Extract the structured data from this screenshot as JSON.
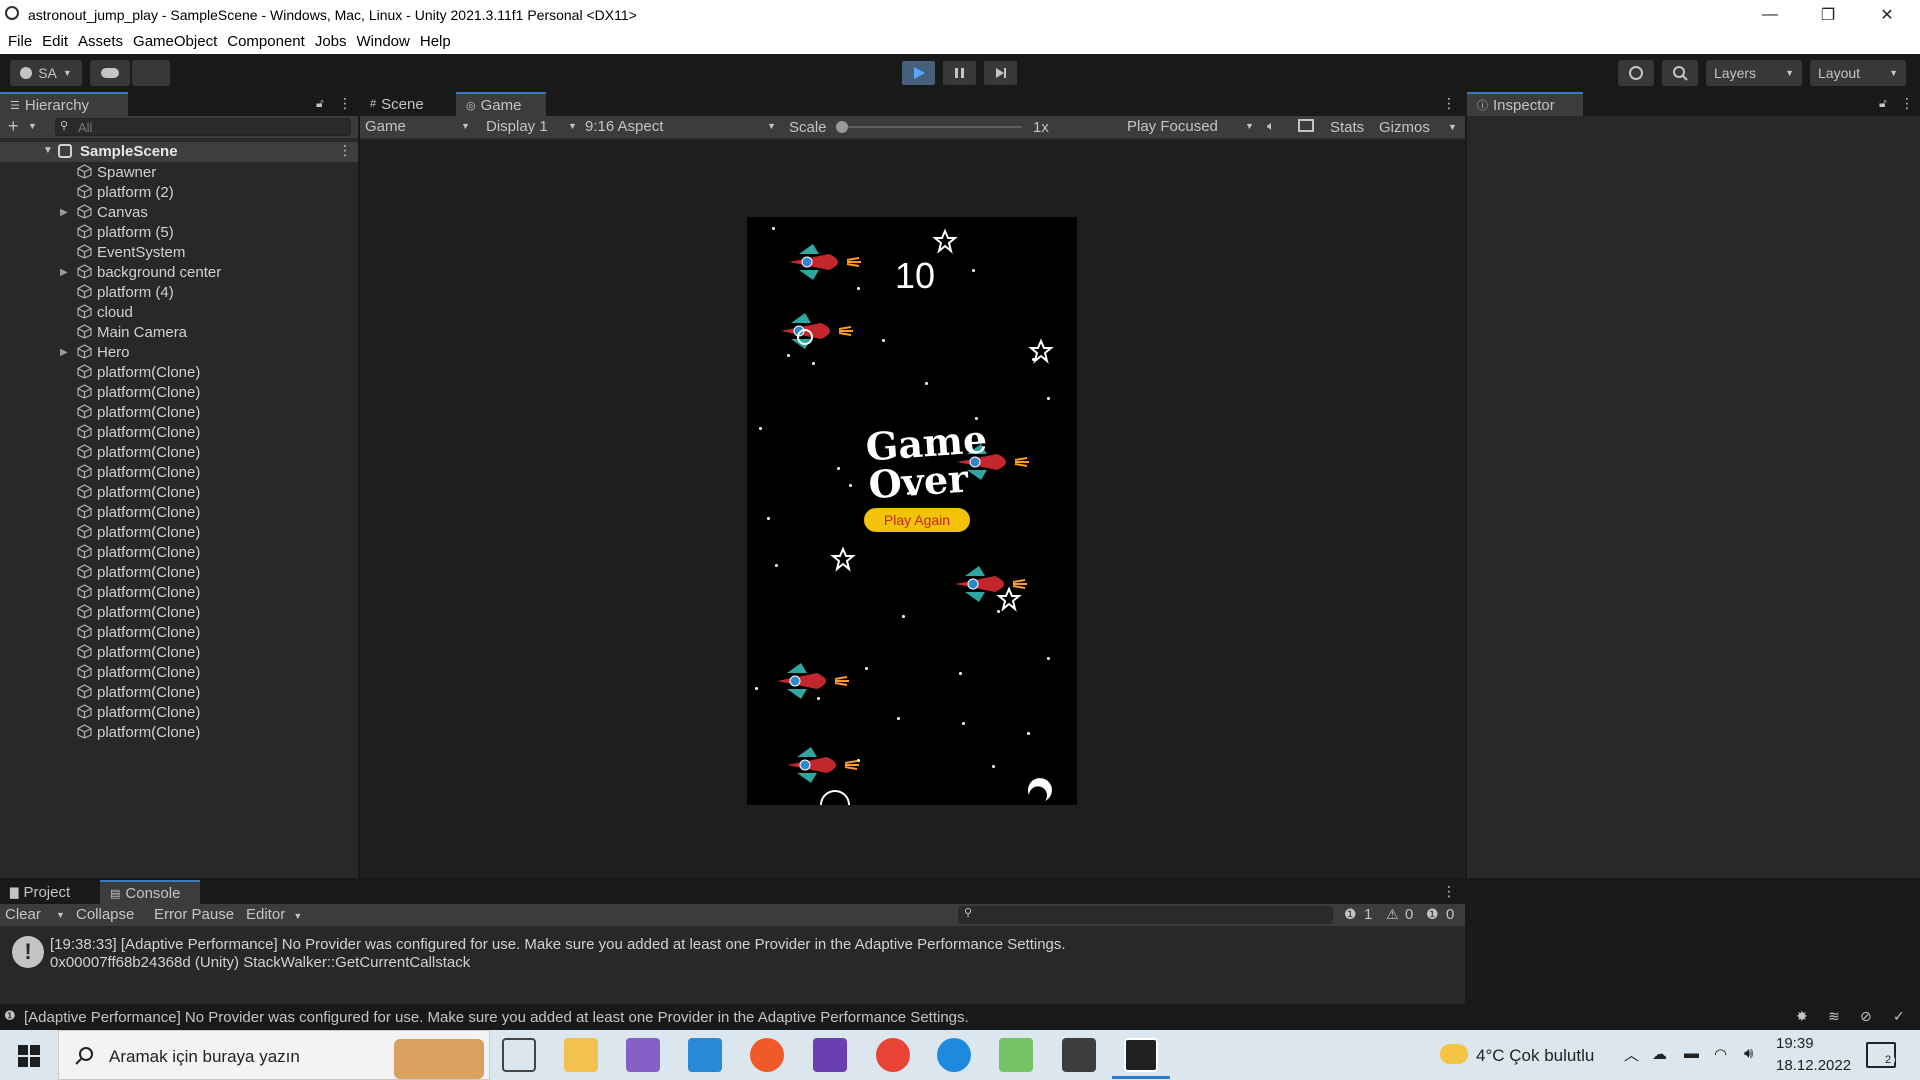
{
  "window": {
    "title": "astronout_jump_play - SampleScene - Windows, Mac, Linux - Unity 2021.3.11f1 Personal <DX11>",
    "min": "—",
    "max": "❐",
    "close": "✕"
  },
  "menu": [
    "File",
    "Edit",
    "Assets",
    "GameObject",
    "Component",
    "Jobs",
    "Window",
    "Help"
  ],
  "toolbar": {
    "account": "SA",
    "layers": "Layers",
    "layout": "Layout"
  },
  "hierarchy": {
    "tab": "Hierarchy",
    "search_placeholder": "All",
    "scene": "SampleScene",
    "items": [
      {
        "name": "Spawner",
        "expandable": false
      },
      {
        "name": "platform (2)",
        "expandable": false
      },
      {
        "name": "Canvas",
        "expandable": true
      },
      {
        "name": "platform (5)",
        "expandable": false
      },
      {
        "name": "EventSystem",
        "expandable": false
      },
      {
        "name": "background center",
        "expandable": true
      },
      {
        "name": "platform (4)",
        "expandable": false
      },
      {
        "name": "cloud",
        "expandable": false
      },
      {
        "name": "Main Camera",
        "expandable": false
      },
      {
        "name": "Hero",
        "expandable": true
      },
      {
        "name": "platform(Clone)",
        "expandable": false
      },
      {
        "name": "platform(Clone)",
        "expandable": false
      },
      {
        "name": "platform(Clone)",
        "expandable": false
      },
      {
        "name": "platform(Clone)",
        "expandable": false
      },
      {
        "name": "platform(Clone)",
        "expandable": false
      },
      {
        "name": "platform(Clone)",
        "expandable": false
      },
      {
        "name": "platform(Clone)",
        "expandable": false
      },
      {
        "name": "platform(Clone)",
        "expandable": false
      },
      {
        "name": "platform(Clone)",
        "expandable": false
      },
      {
        "name": "platform(Clone)",
        "expandable": false
      },
      {
        "name": "platform(Clone)",
        "expandable": false
      },
      {
        "name": "platform(Clone)",
        "expandable": false
      },
      {
        "name": "platform(Clone)",
        "expandable": false
      },
      {
        "name": "platform(Clone)",
        "expandable": false
      },
      {
        "name": "platform(Clone)",
        "expandable": false
      },
      {
        "name": "platform(Clone)",
        "expandable": false
      },
      {
        "name": "platform(Clone)",
        "expandable": false
      },
      {
        "name": "platform(Clone)",
        "expandable": false
      },
      {
        "name": "platform(Clone)",
        "expandable": false
      }
    ]
  },
  "view_tabs": {
    "scene": "Scene",
    "game": "Game"
  },
  "game_toolbar": {
    "mode": "Game",
    "display": "Display 1",
    "aspect": "9:16 Aspect",
    "scale_label": "Scale",
    "scale_value": "1x",
    "play_focused": "Play Focused",
    "stats": "Stats",
    "gizmos": "Gizmos"
  },
  "game": {
    "score": "10",
    "game_over_line1": "Game",
    "game_over_line2": "Over",
    "play_again": "Play Again"
  },
  "inspector": {
    "tab": "Inspector"
  },
  "bottom_tabs": {
    "project": "Project",
    "console": "Console"
  },
  "console": {
    "clear": "Clear",
    "collapse": "Collapse",
    "error_pause": "Error Pause",
    "editor": "Editor",
    "count_log": "1",
    "count_warn": "0",
    "count_error": "0",
    "message_line1": "[19:38:33] [Adaptive Performance] No Provider was configured for use. Make sure you added at least one Provider in the Adaptive Performance Settings.",
    "message_line2": "0x00007ff68b24368d (Unity) StackWalker::GetCurrentCallstack"
  },
  "statusbar": {
    "message": "[Adaptive Performance] No Provider was configured for use. Make sure you added at least one Provider in the Adaptive Performance Settings."
  },
  "taskbar": {
    "search_placeholder": "Aramak için buraya yazın",
    "weather": "4°C  Çok bulutlu",
    "time": "19:39",
    "date": "18.12.2022",
    "notifications": "2"
  }
}
